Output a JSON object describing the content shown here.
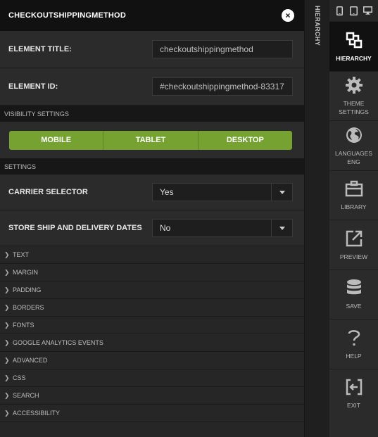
{
  "panel": {
    "title": "CHECKOUTSHIPPINGMETHOD",
    "close_glyph": "×"
  },
  "fields": {
    "element_title_label": "ELEMENT TITLE:",
    "element_title_value": "checkoutshippingmethod",
    "element_id_label": "ELEMENT ID:",
    "element_id_value": "#checkoutshippingmethod-83317"
  },
  "visibility": {
    "heading": "VISIBILITY SETTINGS",
    "buttons": [
      "MOBILE",
      "TABLET",
      "DESKTOP"
    ],
    "accent_color": "#76a232"
  },
  "settings": {
    "heading": "SETTINGS",
    "carrier_label": "CARRIER SELECTOR",
    "carrier_value": "Yes",
    "ship_label": "STORE SHIP AND DELIVERY DATES",
    "ship_value": "No"
  },
  "accordion": [
    "TEXT",
    "MARGIN",
    "PADDING",
    "BORDERS",
    "FONTS",
    "GOOGLE ANALYTICS EVENTS",
    "ADVANCED",
    "CSS",
    "SEARCH",
    "ACCESSIBILITY"
  ],
  "hierarchy_tab": "HIERARCHY",
  "rail": {
    "hierarchy": "HIERARCHY",
    "theme": [
      "THEME",
      "SETTINGS"
    ],
    "languages": [
      "LANGUAGES",
      "ENG"
    ],
    "library": "LIBRARY",
    "preview": "PREVIEW",
    "save": "SAVE",
    "help": "HELP",
    "exit": "EXIT"
  }
}
